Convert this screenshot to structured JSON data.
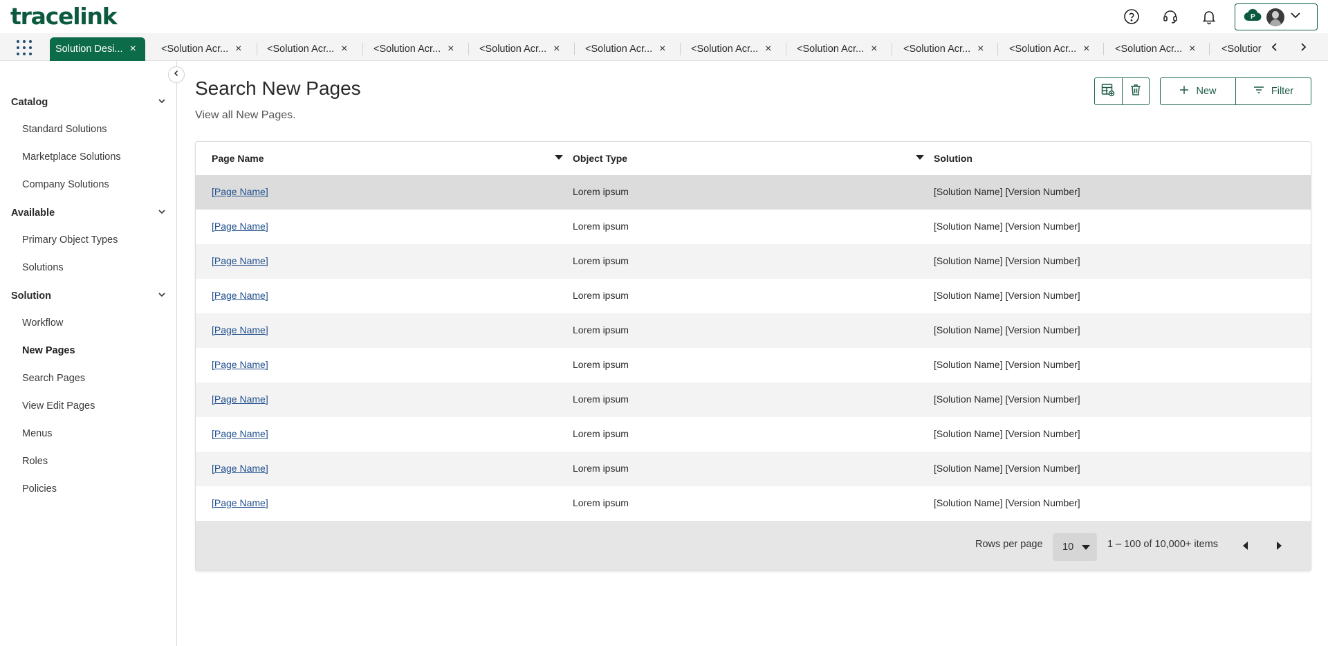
{
  "app": {
    "logo": "tracelink",
    "accent": "#0c6b48"
  },
  "header": {
    "icons": [
      "help-icon",
      "support-headset-icon",
      "notification-bell-icon"
    ],
    "account": {
      "cloud_icon": "cloud-p-icon",
      "chevron": "chevron-down-icon"
    }
  },
  "tabs": {
    "items": [
      {
        "label": "Solution Desi..."
      },
      {
        "label": "<Solution Acr..."
      },
      {
        "label": "<Solution Acr..."
      },
      {
        "label": "<Solution Acr..."
      },
      {
        "label": "<Solution Acr..."
      },
      {
        "label": "<Solution Acr..."
      },
      {
        "label": "<Solution Acr..."
      },
      {
        "label": "<Solution Acr..."
      },
      {
        "label": "<Solution Acr..."
      },
      {
        "label": "<Solution Acr..."
      },
      {
        "label": "<Solution Acr..."
      },
      {
        "label": "<Solutior"
      }
    ],
    "close": "×"
  },
  "sidebar": {
    "sections": [
      {
        "title": "Catalog",
        "items": [
          "Standard Solutions",
          "Marketplace Solutions",
          "Company Solutions"
        ]
      },
      {
        "title": "Available",
        "items": [
          "Primary Object Types",
          "Solutions"
        ]
      },
      {
        "title": "Solution",
        "items": [
          "Workflow",
          "New Pages",
          "Search Pages",
          "View Edit Pages",
          "Menus",
          "Roles",
          "Policies"
        ]
      }
    ],
    "current": "New Pages"
  },
  "page": {
    "title": "Search New Pages",
    "subtitle": "View all New Pages."
  },
  "toolbar": {
    "new_label": "New",
    "filter_label": "Filter"
  },
  "table": {
    "columns": [
      "Page Name",
      "Object Type",
      "Solution"
    ],
    "rows": [
      [
        "[Page Name]",
        "Lorem ipsum",
        "[Solution Name] [Version Number]"
      ],
      [
        "[Page Name]",
        "Lorem ipsum",
        "[Solution Name] [Version Number]"
      ],
      [
        "[Page Name]",
        "Lorem ipsum",
        "[Solution Name] [Version Number]"
      ],
      [
        "[Page Name]",
        "Lorem ipsum",
        "[Solution Name] [Version Number]"
      ],
      [
        "[Page Name]",
        "Lorem ipsum",
        "[Solution Name] [Version Number]"
      ],
      [
        "[Page Name]",
        "Lorem ipsum",
        "[Solution Name] [Version Number]"
      ],
      [
        "[Page Name]",
        "Lorem ipsum",
        "[Solution Name] [Version Number]"
      ],
      [
        "[Page Name]",
        "Lorem ipsum",
        "[Solution Name] [Version Number]"
      ],
      [
        "[Page Name]",
        "Lorem ipsum",
        "[Solution Name] [Version Number]"
      ],
      [
        "[Page Name]",
        "Lorem ipsum",
        "[Solution Name] [Version Number]"
      ]
    ]
  },
  "pagination": {
    "rows_per_page_label": "Rows per page",
    "rows_per_page_value": "10",
    "range_text": "1 – 100 of 10,000+ items"
  }
}
